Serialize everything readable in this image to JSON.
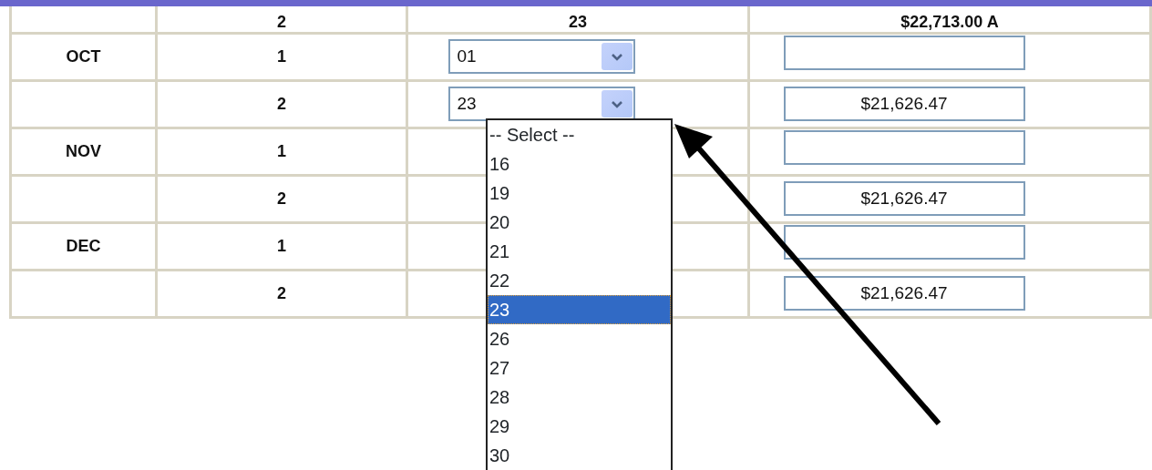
{
  "top_row": {
    "cells": [
      "2",
      "23",
      "$22,713.00 A"
    ]
  },
  "rows": [
    {
      "month": "OCT",
      "half": "1",
      "day": {
        "value": "01",
        "expanded": false
      },
      "amount_field": true
    },
    {
      "half": "2",
      "day": {
        "value": "23",
        "expanded": true
      },
      "amount_field": true,
      "amount": {
        "value": "$21,626.47"
      }
    },
    {
      "month": "NOV",
      "half": "1",
      "amount_field": true
    },
    {
      "half": "2",
      "amount_field": true,
      "amount": {
        "value": "$21,626.47"
      }
    },
    {
      "month": "DEC",
      "half": "1",
      "amount_field": true
    },
    {
      "half": "2",
      "amount_field": true,
      "amount": {
        "value": "$21,626.47"
      }
    }
  ],
  "open_list": {
    "options": [
      {
        "label": "-- Select --",
        "selected": false
      },
      {
        "label": "16",
        "selected": false
      },
      {
        "label": "19",
        "selected": false
      },
      {
        "label": "20",
        "selected": false
      },
      {
        "label": "21",
        "selected": false
      },
      {
        "label": "22",
        "selected": false
      },
      {
        "label": "23",
        "selected": true
      },
      {
        "label": "26",
        "selected": false
      },
      {
        "label": "27",
        "selected": false
      },
      {
        "label": "28",
        "selected": false
      },
      {
        "label": "29",
        "selected": false
      },
      {
        "label": "30",
        "selected": false
      }
    ]
  }
}
